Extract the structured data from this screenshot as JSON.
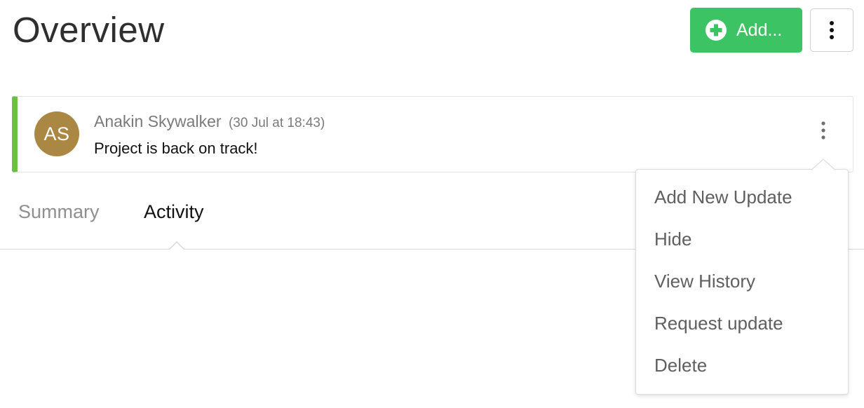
{
  "header": {
    "title": "Overview",
    "add_button_label": "Add..."
  },
  "update": {
    "avatar_initials": "AS",
    "author": "Anakin Skywalker",
    "timestamp": "(30 Jul at 18:43)",
    "message": "Project is back on track!"
  },
  "tabs": [
    {
      "label": "Summary",
      "active": false
    },
    {
      "label": "Activity",
      "active": true
    }
  ],
  "menu": {
    "items": [
      {
        "label": "Add New Update"
      },
      {
        "label": "Hide"
      },
      {
        "label": "View History"
      },
      {
        "label": "Request update"
      },
      {
        "label": "Delete"
      }
    ]
  },
  "colors": {
    "add_button": "#3cc363",
    "status_bar": "#6cbf43",
    "avatar": "#ab8744"
  },
  "icons": {
    "add": "plus-circle-icon",
    "more": "vertical-ellipsis-icon"
  }
}
